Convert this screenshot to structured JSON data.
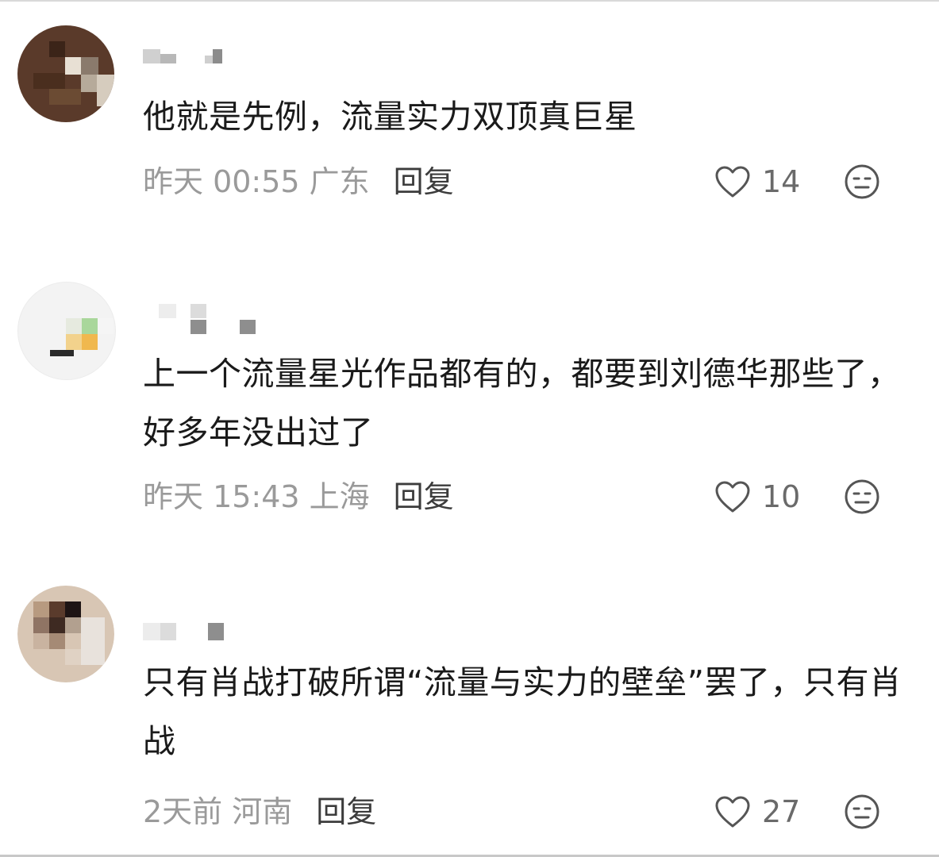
{
  "comments": [
    {
      "text": "他就是先例，流量实力双顶真巨星",
      "time": "昨天 00:55 广东",
      "reply": "回复",
      "likes": "14"
    },
    {
      "text": "上一个流量星光作品都有的，都要到刘德华那些了，好多年没出过了",
      "time": "昨天 15:43 上海",
      "reply": "回复",
      "likes": "10"
    },
    {
      "text": "只有肖战打破所谓“流量与实力的壁垒”罢了，只有肖战",
      "time": "2天前 河南",
      "reply": "回复",
      "likes": "27"
    }
  ],
  "icons": {
    "like": "heart-outline-icon",
    "dislike": "meh-face-icon"
  },
  "colors": {
    "text": "#1a1a1a",
    "meta": "#9a9a9a",
    "reply": "#3c3c3c",
    "icon": "#555555"
  }
}
